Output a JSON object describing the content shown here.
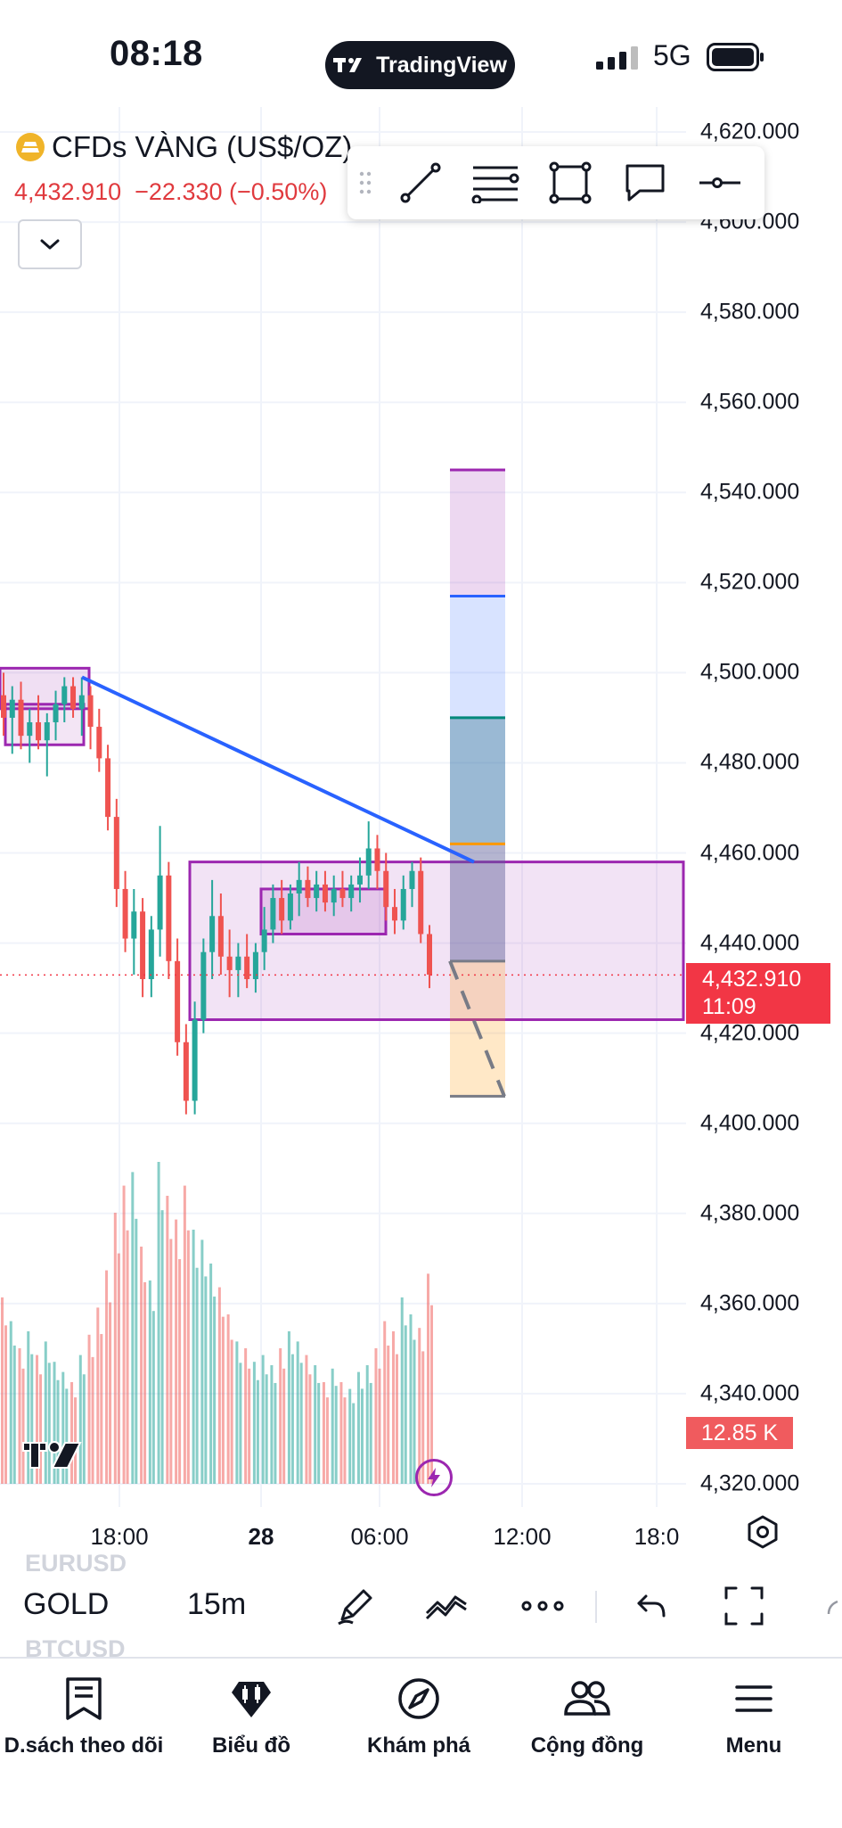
{
  "status_bar": {
    "time": "08:18",
    "app_pill": "TradingView",
    "network": "5G"
  },
  "symbol": {
    "name": "CFDs VÀNG (US$/OZ)",
    "last": "4,432.910",
    "change": "−22.330",
    "change_pct": "(−0.50%)"
  },
  "price_axis": {
    "labels": [
      "4,620.000",
      "4,600.000",
      "4,580.000",
      "4,560.000",
      "4,540.000",
      "4,520.000",
      "4,500.000",
      "4,480.000",
      "4,460.000",
      "4,440.000",
      "4,420.000",
      "4,400.000",
      "4,380.000",
      "4,360.000",
      "4,340.000",
      "4,320.000"
    ],
    "current_price": "4,432.910",
    "countdown": "11:09",
    "volume_label": "12.85 K"
  },
  "time_axis": {
    "labels": [
      "18:00",
      "28",
      "06:00",
      "12:00",
      "18:0"
    ]
  },
  "toolbar": {
    "symbol": "GOLD",
    "interval": "15m",
    "faded_symbol_above": "EURUSD",
    "faded_symbol_below": "BTCUSD"
  },
  "drawing_toolbar": {
    "icons": [
      "drag-handle-icon",
      "trend-line-icon",
      "fib-retracement-icon",
      "rectangle-icon",
      "callout-icon",
      "horizontal-ray-icon"
    ]
  },
  "bottom_nav": [
    {
      "label": "D.sách theo dõi",
      "icon": "watchlist-icon"
    },
    {
      "label": "Biểu đồ",
      "icon": "chart-icon"
    },
    {
      "label": "Khám phá",
      "icon": "compass-icon"
    },
    {
      "label": "Cộng đồng",
      "icon": "community-icon"
    },
    {
      "label": "Menu",
      "icon": "menu-icon"
    }
  ],
  "colors": {
    "up": "#26a69a",
    "down": "#ef5350",
    "box": "#9c27b0",
    "trend_line": "#2962ff",
    "price_tag": "#f23645"
  },
  "chart_data": {
    "type": "candlestick",
    "ylim": [
      4315,
      4625
    ],
    "x_ticks": [
      "18:00",
      "28",
      "06:00",
      "12:00",
      "18:0"
    ],
    "candles_approx": [
      {
        "o": 4495,
        "h": 4500,
        "l": 4486,
        "c": 4490
      },
      {
        "o": 4490,
        "h": 4497,
        "l": 4482,
        "c": 4494
      },
      {
        "o": 4494,
        "h": 4498,
        "l": 4483,
        "c": 4486
      },
      {
        "o": 4486,
        "h": 4492,
        "l": 4480,
        "c": 4489
      },
      {
        "o": 4489,
        "h": 4495,
        "l": 4483,
        "c": 4485
      },
      {
        "o": 4485,
        "h": 4491,
        "l": 4477,
        "c": 4489
      },
      {
        "o": 4489,
        "h": 4496,
        "l": 4485,
        "c": 4493
      },
      {
        "o": 4493,
        "h": 4499,
        "l": 4489,
        "c": 4497
      },
      {
        "o": 4497,
        "h": 4499,
        "l": 4490,
        "c": 4492
      },
      {
        "o": 4492,
        "h": 4499,
        "l": 4486,
        "c": 4495
      },
      {
        "o": 4495,
        "h": 4497,
        "l": 4483,
        "c": 4488
      },
      {
        "o": 4488,
        "h": 4492,
        "l": 4478,
        "c": 4481
      },
      {
        "o": 4481,
        "h": 4484,
        "l": 4465,
        "c": 4468
      },
      {
        "o": 4468,
        "h": 4472,
        "l": 4448,
        "c": 4452
      },
      {
        "o": 4452,
        "h": 4456,
        "l": 4438,
        "c": 4441
      },
      {
        "o": 4441,
        "h": 4452,
        "l": 4433,
        "c": 4447
      },
      {
        "o": 4447,
        "h": 4450,
        "l": 4428,
        "c": 4432
      },
      {
        "o": 4432,
        "h": 4446,
        "l": 4428,
        "c": 4443
      },
      {
        "o": 4443,
        "h": 4466,
        "l": 4437,
        "c": 4455
      },
      {
        "o": 4455,
        "h": 4458,
        "l": 4432,
        "c": 4436
      },
      {
        "o": 4436,
        "h": 4441,
        "l": 4415,
        "c": 4418
      },
      {
        "o": 4418,
        "h": 4422,
        "l": 4402,
        "c": 4405
      },
      {
        "o": 4405,
        "h": 4427,
        "l": 4402,
        "c": 4423
      },
      {
        "o": 4423,
        "h": 4441,
        "l": 4420,
        "c": 4438
      },
      {
        "o": 4438,
        "h": 4454,
        "l": 4432,
        "c": 4446
      },
      {
        "o": 4446,
        "h": 4451,
        "l": 4433,
        "c": 4437
      },
      {
        "o": 4437,
        "h": 4443,
        "l": 4428,
        "c": 4434
      },
      {
        "o": 4434,
        "h": 4440,
        "l": 4428,
        "c": 4437
      },
      {
        "o": 4437,
        "h": 4442,
        "l": 4430,
        "c": 4432
      },
      {
        "o": 4432,
        "h": 4440,
        "l": 4429,
        "c": 4438
      },
      {
        "o": 4438,
        "h": 4448,
        "l": 4434,
        "c": 4443
      },
      {
        "o": 4443,
        "h": 4453,
        "l": 4440,
        "c": 4450
      },
      {
        "o": 4450,
        "h": 4454,
        "l": 4442,
        "c": 4445
      },
      {
        "o": 4445,
        "h": 4453,
        "l": 4443,
        "c": 4451
      },
      {
        "o": 4451,
        "h": 4458,
        "l": 4446,
        "c": 4454
      },
      {
        "o": 4454,
        "h": 4457,
        "l": 4448,
        "c": 4450
      },
      {
        "o": 4450,
        "h": 4456,
        "l": 4447,
        "c": 4453
      },
      {
        "o": 4453,
        "h": 4456,
        "l": 4447,
        "c": 4449
      },
      {
        "o": 4449,
        "h": 4455,
        "l": 4446,
        "c": 4452
      },
      {
        "o": 4452,
        "h": 4456,
        "l": 4448,
        "c": 4450
      },
      {
        "o": 4450,
        "h": 4455,
        "l": 4447,
        "c": 4453
      },
      {
        "o": 4453,
        "h": 4459,
        "l": 4449,
        "c": 4455
      },
      {
        "o": 4455,
        "h": 4467,
        "l": 4452,
        "c": 4461
      },
      {
        "o": 4461,
        "h": 4464,
        "l": 4452,
        "c": 4456
      },
      {
        "o": 4456,
        "h": 4460,
        "l": 4445,
        "c": 4448
      },
      {
        "o": 4448,
        "h": 4452,
        "l": 4442,
        "c": 4445
      },
      {
        "o": 4445,
        "h": 4455,
        "l": 4443,
        "c": 4452
      },
      {
        "o": 4452,
        "h": 4458,
        "l": 4448,
        "c": 4456
      },
      {
        "o": 4456,
        "h": 4459,
        "l": 4440,
        "c": 4442
      },
      {
        "o": 4442,
        "h": 4444,
        "l": 4430,
        "c": 4433
      }
    ],
    "volumes_approx": [
      55,
      48,
      40,
      45,
      38,
      42,
      36,
      33,
      30,
      38,
      44,
      52,
      63,
      80,
      88,
      92,
      70,
      60,
      95,
      85,
      78,
      88,
      75,
      72,
      65,
      58,
      50,
      42,
      40,
      36,
      38,
      35,
      40,
      45,
      42,
      38,
      35,
      30,
      34,
      30,
      28,
      33,
      35,
      40,
      48,
      45,
      55,
      50,
      46,
      62
    ],
    "zones": [
      {
        "top": 4458,
        "bottom": 4423,
        "note": "large range box"
      },
      {
        "top": 4452,
        "bottom": 4442,
        "note": "inner box"
      },
      {
        "top": 4501,
        "bottom": 4492,
        "note": "left box"
      },
      {
        "top": 4493,
        "bottom": 4484,
        "note": "left box lower"
      }
    ],
    "fib_levels": [
      4545,
      4517,
      4490,
      4462,
      4436,
      4406
    ]
  }
}
